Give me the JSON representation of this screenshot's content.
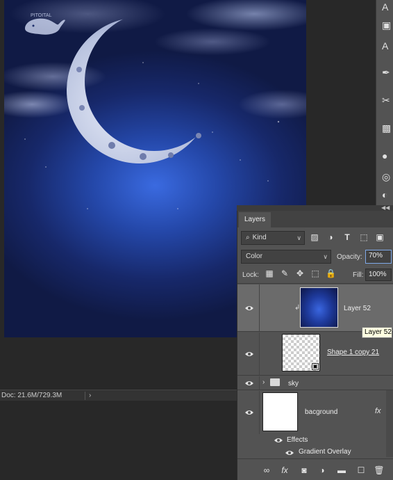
{
  "canvas": {
    "watermark_text": "PITOITAL"
  },
  "status_bar": {
    "doc_text": "Doc: 21.6M/729.3M"
  },
  "layers_panel": {
    "tab_label": "Layers",
    "filter": {
      "kind_label": "Kind"
    },
    "blend_mode": "Color",
    "opacity_label": "Opacity:",
    "opacity_value": "70%",
    "lock_label": "Lock:",
    "fill_label": "Fill:",
    "fill_value": "100%",
    "layers": [
      {
        "name": "Layer 52",
        "selected": true,
        "clipped": true
      },
      {
        "name": "Shape 1 copy 21",
        "selected": false
      },
      {
        "name": "sky",
        "type": "group"
      },
      {
        "name": "bacground",
        "has_fx": true,
        "fx_label": "fx"
      }
    ],
    "effects_label": "Effects",
    "effect_items": [
      "Gradient Overlay"
    ]
  },
  "tooltip": {
    "text": "Layer 52"
  },
  "colors": {
    "panel_bg": "#535353",
    "selected_row": "#6b6b6b",
    "tooltip_bg": "#ffffe1",
    "canvas_glow": "#3a6ae0"
  }
}
